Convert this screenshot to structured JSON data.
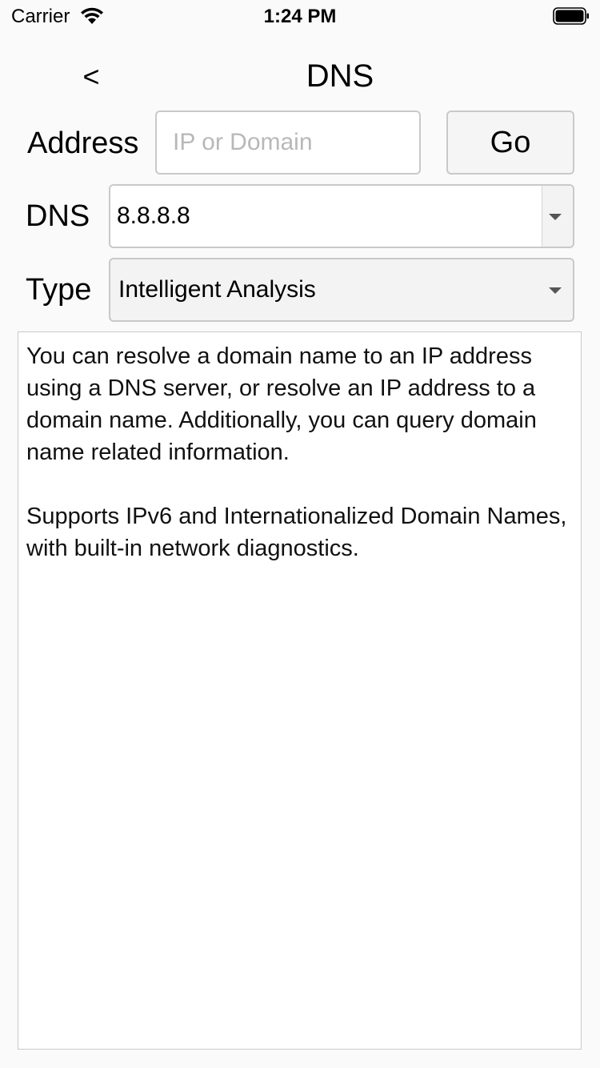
{
  "status_bar": {
    "carrier": "Carrier",
    "time": "1:24 PM"
  },
  "nav": {
    "back_label": "<",
    "title": "DNS"
  },
  "form": {
    "address_label": "Address",
    "address_placeholder": "IP or Domain",
    "address_value": "",
    "go_label": "Go",
    "dns_label": "DNS",
    "dns_value": "8.8.8.8",
    "type_label": "Type",
    "type_value": "Intelligent Analysis"
  },
  "output": {
    "paragraph1": "You can resolve a domain name to an IP address using a DNS server, or resolve an IP address to a domain name. Additionally, you can query domain name related information.",
    "paragraph2": "Supports IPv6 and Internationalized Domain Names, with built-in network diagnostics."
  },
  "icons": {
    "wifi": "wifi-icon",
    "battery": "battery-icon",
    "dropdown": "chevron-down-icon"
  },
  "colors": {
    "background": "#fafafa",
    "border": "#c9c9c9",
    "placeholder": "#b8b8b8"
  }
}
